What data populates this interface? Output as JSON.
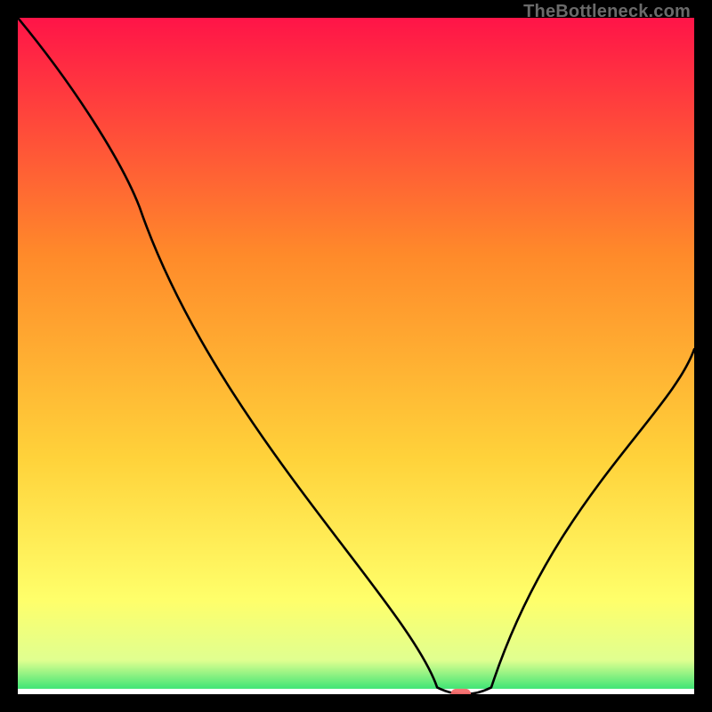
{
  "watermark": "TheBottleneck.com",
  "chart_data": {
    "type": "line",
    "title": "",
    "xlabel": "",
    "ylabel": "",
    "xlim": [
      0,
      100
    ],
    "ylim": [
      0,
      100
    ],
    "grid": false,
    "legend": false,
    "series": [
      {
        "name": "curve",
        "x": [
          0,
          18,
          62,
          66,
          70,
          100
        ],
        "values": [
          100,
          72,
          1,
          0,
          1,
          51
        ]
      }
    ],
    "marker": {
      "x_center": 65.5,
      "y": 0,
      "width_pct": 3,
      "height_pct": 1.6
    },
    "background_gradient": {
      "stops": [
        {
          "pos": 0.0,
          "color": "#ff1448"
        },
        {
          "pos": 0.35,
          "color": "#ff8a2a"
        },
        {
          "pos": 0.65,
          "color": "#ffd23a"
        },
        {
          "pos": 0.86,
          "color": "#ffff6a"
        },
        {
          "pos": 0.95,
          "color": "#e0ff90"
        },
        {
          "pos": 1.0,
          "color": "#20e070"
        }
      ],
      "bottom_white_band_height_pct": 0.8
    }
  }
}
